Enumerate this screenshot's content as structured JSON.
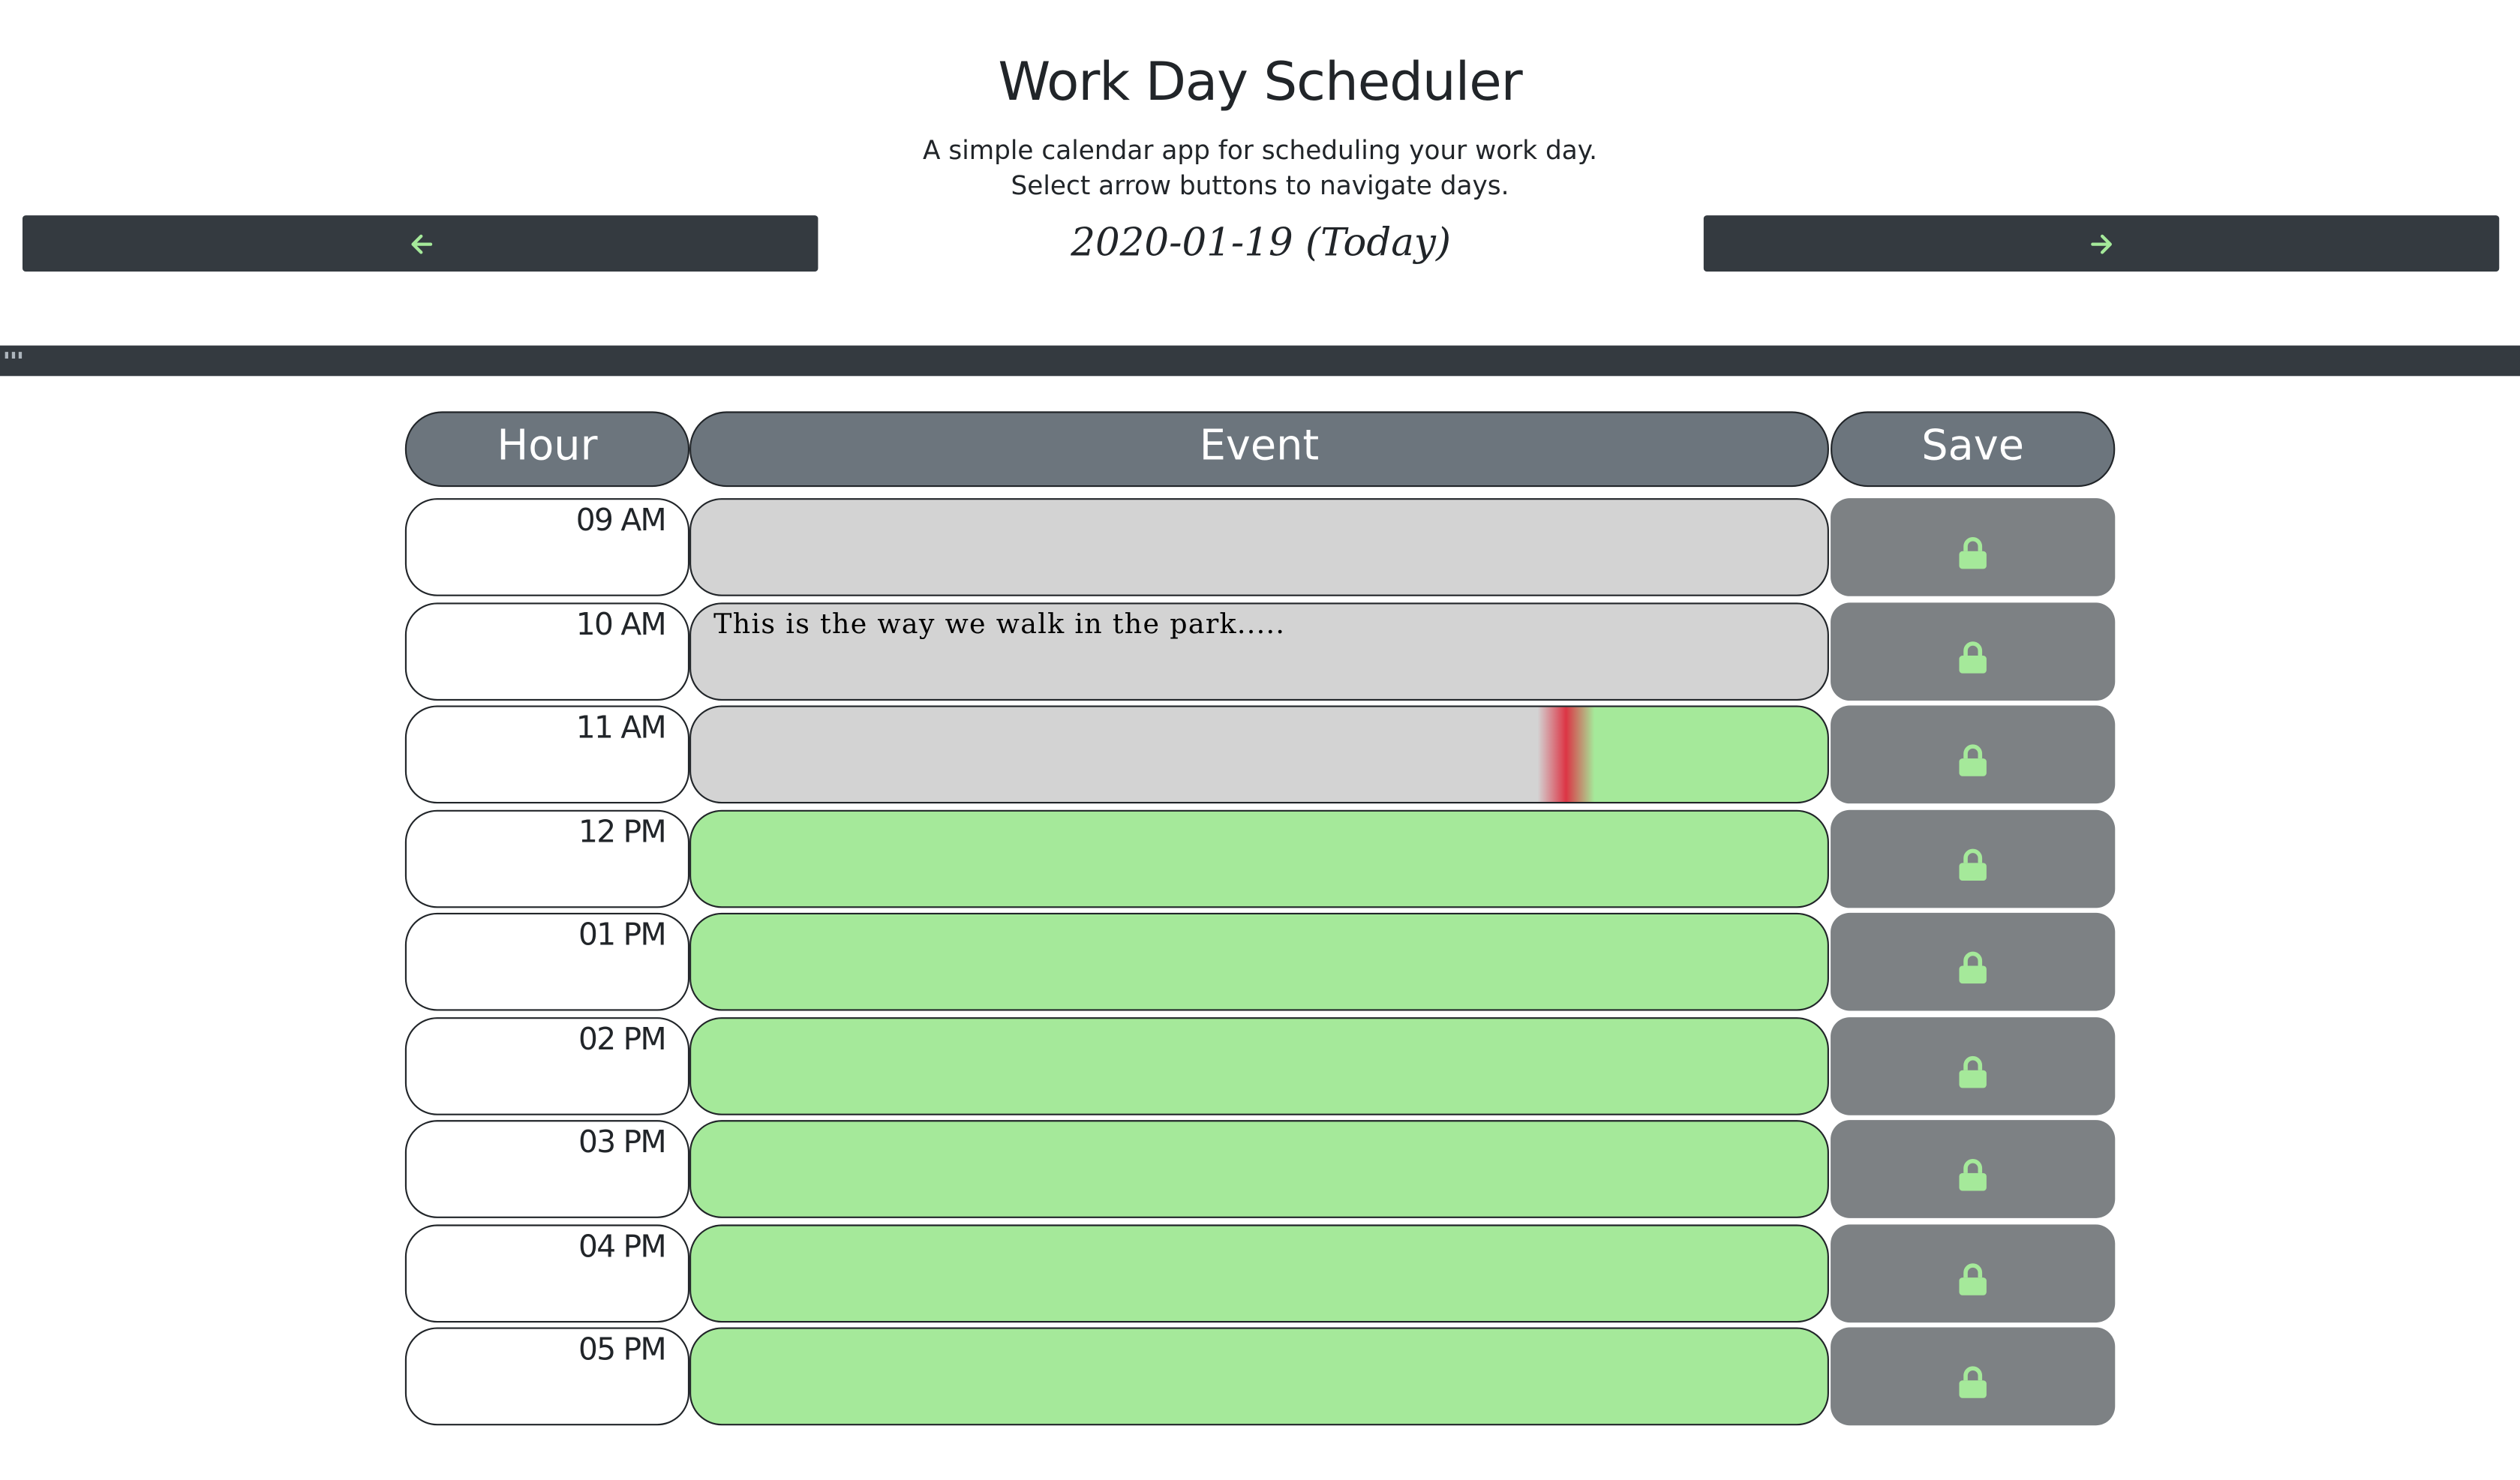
{
  "header": {
    "title": "Work Day Scheduler",
    "subtitle_line1": "A simple calendar app for scheduling your work day.",
    "subtitle_line2": "Select arrow buttons to navigate days.",
    "date_label": "2020-01-19 (Today)",
    "prev_icon": "arrow-left-icon",
    "next_icon": "arrow-right-icon"
  },
  "colors": {
    "nav_bg": "#343a40",
    "arrow": "#a5e99a",
    "past": "#d3d3d3",
    "future": "#a5e99a",
    "now_marker": "#dc3545",
    "header_cell": "#6c757d",
    "save_bg": "#7d8184",
    "lock": "#a5e99a"
  },
  "table": {
    "headers": {
      "hour": "Hour",
      "event": "Event",
      "save": "Save"
    },
    "rows": [
      {
        "hour": "09 AM",
        "event": "",
        "state": "past",
        "save_icon": "lock-icon"
      },
      {
        "hour": "10 AM",
        "event": "This is the way we walk in the park.....",
        "state": "past",
        "save_icon": "lock-icon"
      },
      {
        "hour": "11 AM",
        "event": "",
        "state": "present",
        "save_icon": "lock-icon"
      },
      {
        "hour": "12 PM",
        "event": "",
        "state": "future",
        "save_icon": "lock-icon"
      },
      {
        "hour": "01 PM",
        "event": "",
        "state": "future",
        "save_icon": "lock-icon"
      },
      {
        "hour": "02 PM",
        "event": "",
        "state": "future",
        "save_icon": "lock-icon"
      },
      {
        "hour": "03 PM",
        "event": "",
        "state": "future",
        "save_icon": "lock-icon"
      },
      {
        "hour": "04 PM",
        "event": "",
        "state": "future",
        "save_icon": "lock-icon"
      },
      {
        "hour": "05 PM",
        "event": "",
        "state": "future",
        "save_icon": "lock-icon"
      }
    ]
  }
}
